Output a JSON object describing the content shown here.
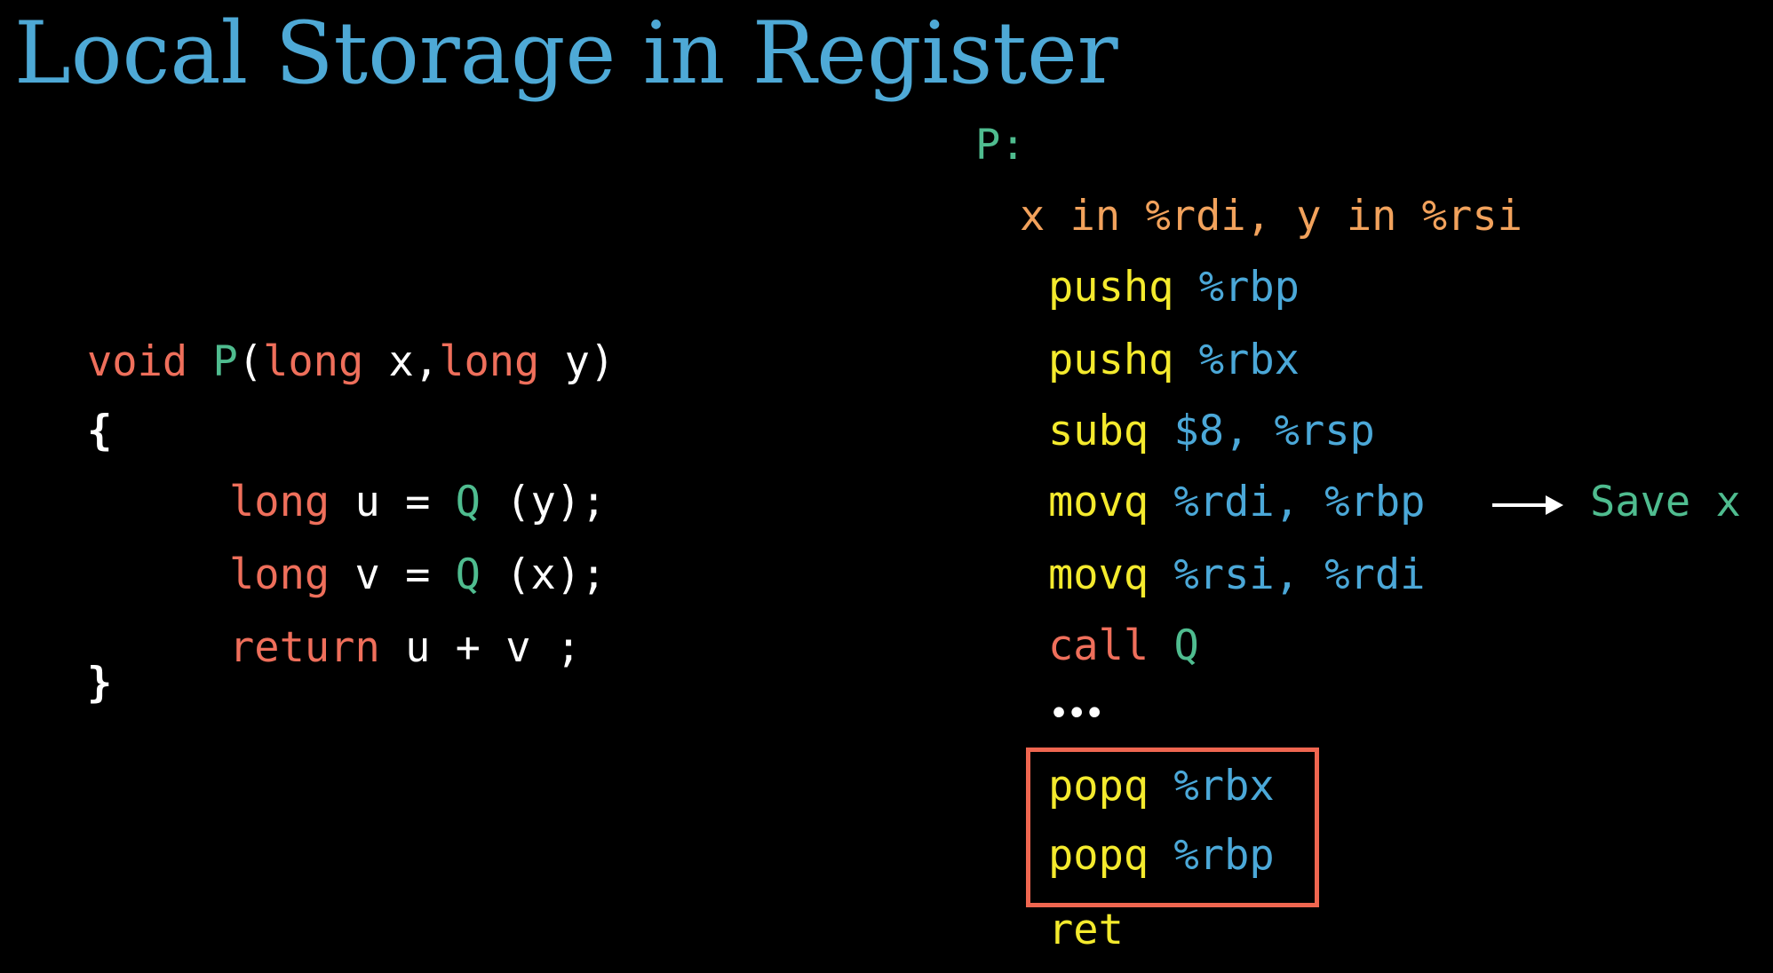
{
  "title": "Local Storage in Register",
  "c_code": {
    "line1": {
      "kw_void": "void",
      "fn_name": "P",
      "paren_open": "(",
      "kw_long1": "long",
      "arg1": " x,",
      "kw_long2": "long",
      "arg2": " y)"
    },
    "brace_open": "{",
    "line2": {
      "kw": "long",
      "var": " u = ",
      "fn": "Q",
      "rest": " (y);"
    },
    "line3": {
      "kw": "long",
      "var": " v = ",
      "fn": "Q",
      "rest": " (x);"
    },
    "line4": {
      "kw": "return",
      "rest": " u + v ;"
    },
    "brace_close": "}"
  },
  "asm": {
    "label": "P:",
    "comment": "x in %rdi, y in %rsi",
    "instructions": [
      {
        "op": "pushq",
        "args": " %rbp"
      },
      {
        "op": "pushq",
        "args": " %rbx"
      },
      {
        "op": "subq",
        "args": " $8, %rsp"
      },
      {
        "op": "movq",
        "args": " %rdi, %rbp"
      },
      {
        "op": "movq",
        "args": " %rsi, %rdi"
      },
      {
        "op": "call",
        "args": " Q"
      },
      {
        "op": "•••",
        "args": ""
      },
      {
        "op": "popq",
        "args": " %rbx"
      },
      {
        "op": "popq",
        "args": " %rbp"
      },
      {
        "op": "ret",
        "args": ""
      }
    ],
    "annotation": "Save x"
  },
  "colors": {
    "title": "#4ea9d6",
    "keyword": "#ef6f5b",
    "function": "#4fbc8f",
    "instruction": "#f4ea2d",
    "register": "#4ba8d8",
    "comment": "#f2a25c",
    "highlight_box": "#ef6650"
  }
}
